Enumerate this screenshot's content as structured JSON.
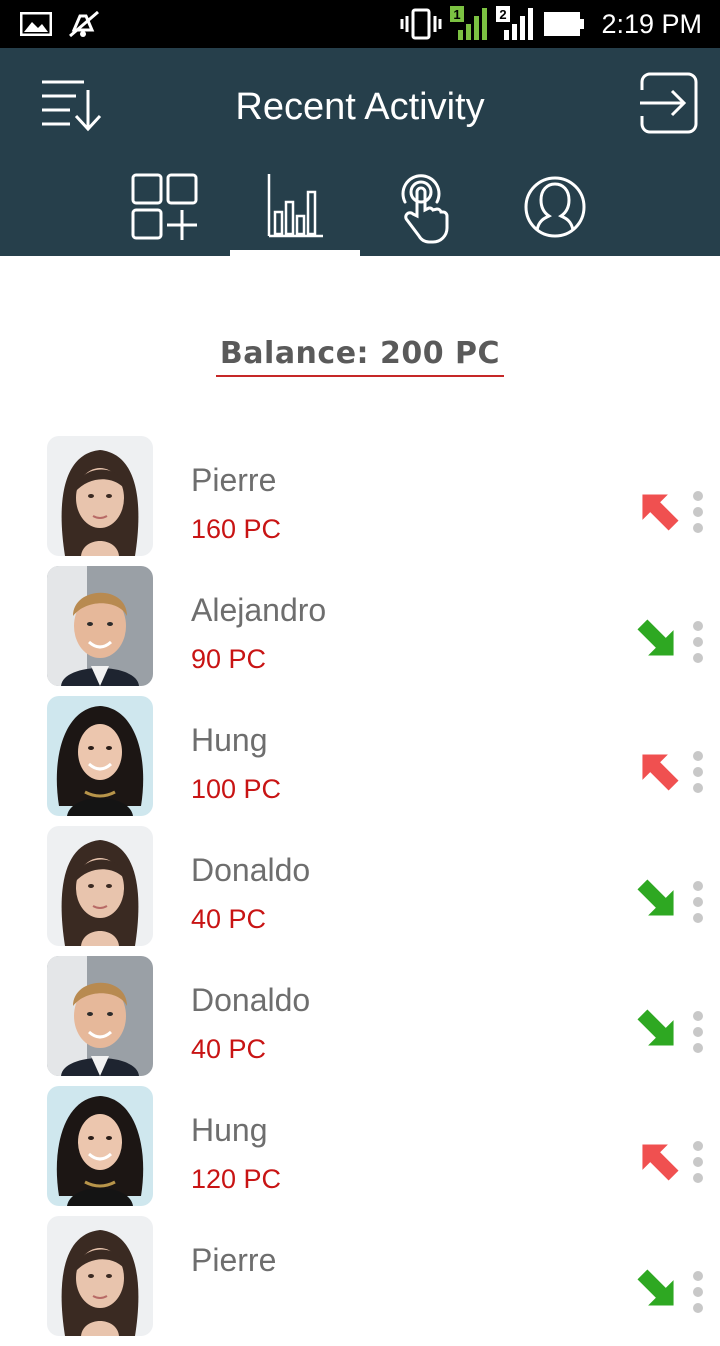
{
  "status_bar": {
    "time": "2:19 PM",
    "icons": [
      "image-icon",
      "mute-icon",
      "vibrate-icon",
      "signal-sim1-icon",
      "signal-sim2-icon",
      "battery-icon"
    ]
  },
  "header": {
    "title": "Recent Activity",
    "menu_icon": "sort-list-icon",
    "logout_icon": "logout-icon",
    "tabs": [
      {
        "icon": "dashboard-add-icon",
        "active": false
      },
      {
        "icon": "bar-chart-icon",
        "active": true
      },
      {
        "icon": "touch-icon",
        "active": false
      },
      {
        "icon": "profile-icon",
        "active": false
      }
    ]
  },
  "balance": {
    "text": "Balance: 200 PC"
  },
  "activity": [
    {
      "name": "Pierre",
      "amount": "160 PC",
      "direction": "outgoing",
      "avatar": "woman-brunette"
    },
    {
      "name": "Alejandro",
      "amount": "90 PC",
      "direction": "incoming",
      "avatar": "man-blond"
    },
    {
      "name": "Hung",
      "amount": "100 PC",
      "direction": "outgoing",
      "avatar": "woman-curly"
    },
    {
      "name": "Donaldo",
      "amount": "40 PC",
      "direction": "incoming",
      "avatar": "woman-brunette"
    },
    {
      "name": "Donaldo",
      "amount": "40 PC",
      "direction": "incoming",
      "avatar": "man-blond"
    },
    {
      "name": "Hung",
      "amount": "120 PC",
      "direction": "outgoing",
      "avatar": "woman-curly"
    },
    {
      "name": "Pierre",
      "amount": "",
      "direction": "incoming",
      "avatar": "woman-brunette"
    }
  ],
  "colors": {
    "header_bg": "#263f4b",
    "amount_text": "#c81414",
    "outgoing_arrow": "#f05050",
    "incoming_arrow": "#2ea822",
    "balance_underline": "#c62828"
  }
}
